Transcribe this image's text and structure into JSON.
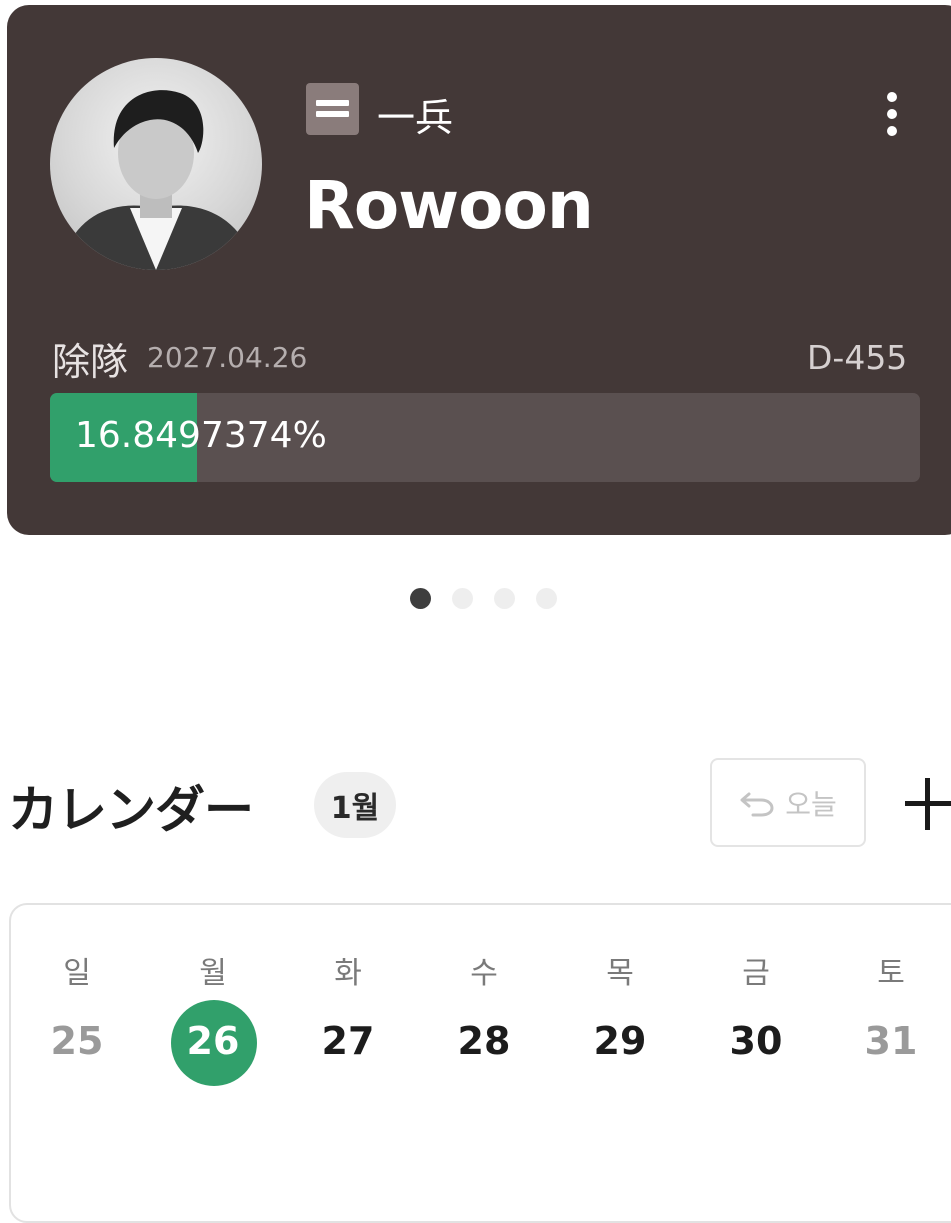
{
  "profile": {
    "rank_label": "一兵",
    "name": "Rowoon",
    "discharge_label": "除隊",
    "discharge_date": "2027.04.26",
    "d_day": "D-455",
    "progress_text": "16.8497374%",
    "progress_fraction": 0.168497374
  },
  "pager": {
    "total": 4,
    "active_index": 0
  },
  "calendar": {
    "title": "カレンダー",
    "month": "1월",
    "today_button": "오늘",
    "weekdays": [
      "일",
      "월",
      "화",
      "수",
      "목",
      "금",
      "토"
    ],
    "days": [
      "25",
      "26",
      "27",
      "28",
      "29",
      "30",
      "31"
    ],
    "selected_index": 1,
    "muted_indices": [
      0,
      6
    ]
  },
  "colors": {
    "card_bg": "#433837",
    "accent_green": "#31a06b",
    "progress_track": "#5a5050"
  },
  "icons": [
    "rank-insignia-icon",
    "more-vertical-icon",
    "undo-arrow-icon",
    "plus-icon"
  ]
}
